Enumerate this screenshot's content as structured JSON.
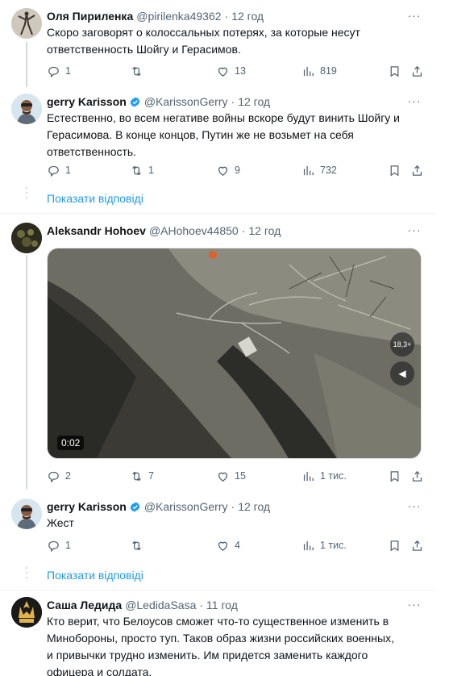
{
  "tweets": [
    {
      "name": "Оля Пириленка",
      "handle": "@pirilenka49362",
      "sep": "·",
      "time": "12 год",
      "text": "Скоро заговорят о колоссальных потерях, за которые несут ответственность Шойгу и Герасимов.",
      "replies": "1",
      "reposts": "",
      "likes": "13",
      "views": "819"
    },
    {
      "name": "gerry Karisson",
      "handle": "@KarissonGerry",
      "sep": "·",
      "time": "12 год",
      "text": "Естественно, во всем негативе войны вскоре будут винить Шойгу и Герасимова. В конце концов, Путин же не возьмет на себя ответственность.",
      "replies": "1",
      "reposts": "1",
      "likes": "9",
      "views": "732"
    },
    {
      "name": "Aleksandr Hohoev",
      "handle": "@AHohoev44850",
      "sep": "·",
      "time": "12 год",
      "duration": "0:02",
      "badge": "18,3+",
      "replies": "2",
      "reposts": "7",
      "likes": "15",
      "views": "1 тис."
    },
    {
      "name": "gerry Karisson",
      "handle": "@KarissonGerry",
      "sep": "·",
      "time": "12 год",
      "text": "Жест",
      "replies": "1",
      "reposts": "",
      "likes": "4",
      "views": "1 тис."
    },
    {
      "name": "Саша Ледида",
      "handle": "@LedidaSasa",
      "sep": "·",
      "time": "11 год",
      "text": "Кто верит, что Белоусов сможет что-то существенное изменить в Минобороны, просто туп. Таков образ жизни российских военных, и привычки трудно изменить. Им придется заменить каждого офицера и солдата."
    }
  ],
  "show_replies_label": "Показати відповіді",
  "more_label": "···",
  "colors": {
    "accent": "#1d9bf0",
    "muted": "#536471",
    "text": "#0f1419"
  },
  "icons": [
    "reply-icon",
    "repost-icon",
    "like-icon",
    "views-icon",
    "bookmark-icon",
    "share-icon",
    "verified-badge-icon",
    "more-icon"
  ]
}
